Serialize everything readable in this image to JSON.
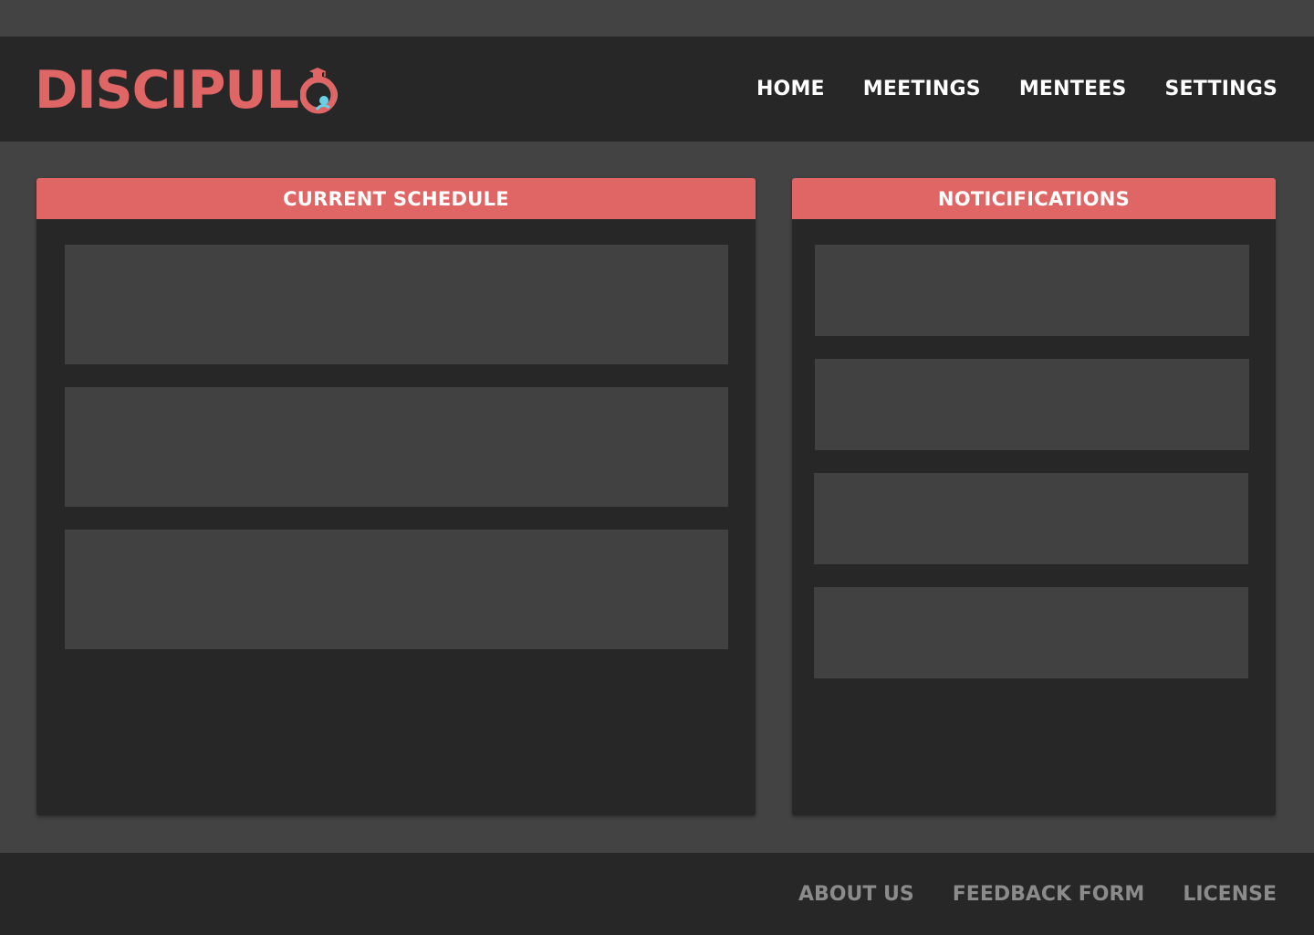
{
  "brand": {
    "name": "DISCIPUL",
    "logo_icon": "graduation-cap-o-icon",
    "colors": {
      "accent": "#e06666",
      "logo_secondary": "#6ad0e6",
      "background": "#434343",
      "panel": "#272727",
      "card": "#414141",
      "footer_link": "#8b8b8b"
    }
  },
  "nav": {
    "items": [
      {
        "label": "HOME"
      },
      {
        "label": "MEETINGS"
      },
      {
        "label": "MENTEES"
      },
      {
        "label": "SETTINGS"
      }
    ]
  },
  "schedule": {
    "title": "CURRENT SCHEDULE",
    "cards": 3
  },
  "notifications": {
    "title": "NOTICIFICATIONS",
    "cards": 4
  },
  "footer": {
    "links": [
      {
        "label": "ABOUT US"
      },
      {
        "label": "FEEDBACK FORM"
      },
      {
        "label": "LICENSE"
      }
    ]
  }
}
